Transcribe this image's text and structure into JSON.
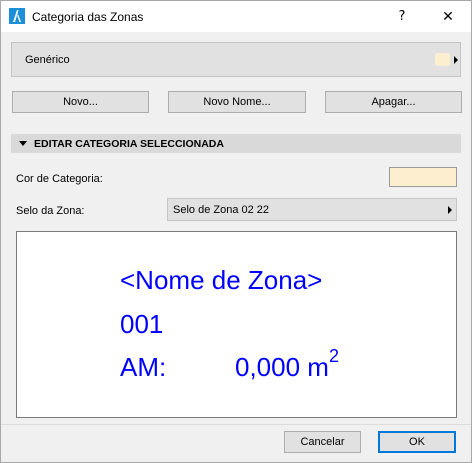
{
  "window": {
    "title": "Categoria das Zonas",
    "help_label": "?",
    "close_label": "✕"
  },
  "category_dropdown": {
    "value": "Genérico",
    "color": "#fdeed0"
  },
  "actions": {
    "new_label": "Novo...",
    "new_name_label": "Novo Nome...",
    "delete_label": "Apagar..."
  },
  "section": {
    "title": "EDITAR CATEGORIA SELECCIONADA"
  },
  "form": {
    "color_label": "Cor de Categoria:",
    "color_value": "#fdeed0",
    "stamp_label": "Selo da Zona:",
    "stamp_value": "Selo de Zona 02 22"
  },
  "preview": {
    "zone_name": "<Nome de Zona>",
    "zone_number": "001",
    "area_label": "AM:",
    "area_value": "0,000 m",
    "area_exponent": "2",
    "text_color": "#0000ff"
  },
  "footer": {
    "cancel_label": "Cancelar",
    "ok_label": "OK"
  }
}
